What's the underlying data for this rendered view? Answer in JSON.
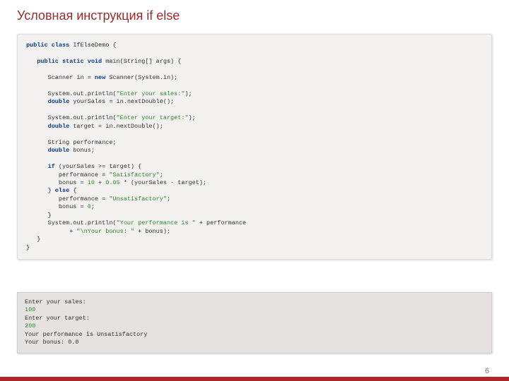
{
  "title": "Условная инструкция if else",
  "code": {
    "l01a": "public class",
    "l01b": " IfElseDemo {",
    "l02": "",
    "l03a": "   public static void",
    "l03b": " main(String[] args) {",
    "l04": "",
    "l05a": "      Scanner in = ",
    "l05b": "new",
    "l05c": " Scanner(System.in);",
    "l06": "",
    "l07a": "      System.out.println(",
    "l07b": "\"Enter your sales:\"",
    "l07c": ");",
    "l08a": "      double",
    "l08b": " yourSales = in.nextDouble();",
    "l09": "",
    "l10a": "      System.out.println(",
    "l10b": "\"Enter your target:\"",
    "l10c": ");",
    "l11a": "      double",
    "l11b": " target = in.nextDouble();",
    "l12": "",
    "l13": "      String performance;",
    "l14a": "      double",
    "l14b": " bonus;",
    "l15": "",
    "l16a": "      if",
    "l16b": " (yourSales >= target) {",
    "l17a": "         performance = ",
    "l17b": "\"Satisfactory\"",
    "l17c": ";",
    "l18a": "         bonus = ",
    "l18b": "10",
    "l18c": " + ",
    "l18d": "0.05",
    "l18e": " * (yourSales - target);",
    "l19a": "      } ",
    "l19b": "else",
    "l19c": " {",
    "l20a": "         performance = ",
    "l20b": "\"Unsatisfactory\"",
    "l20c": ";",
    "l21a": "         bonus = ",
    "l21b": "0",
    "l21c": ";",
    "l22": "      }",
    "l23a": "      System.out.println(",
    "l23b": "\"Your performance is \"",
    "l23c": " + performance",
    "l24a": "            + ",
    "l24b": "\"\\nYour bonus: \"",
    "l24c": " + bonus);",
    "l25": "   }",
    "l26": "}"
  },
  "output": {
    "l1": "Enter your sales:",
    "l2": "100",
    "l3": "Enter your target:",
    "l4": "200",
    "l5": "Your performance is Unsatisfactory",
    "l6": "Your bonus: 0.0"
  },
  "page": "6"
}
